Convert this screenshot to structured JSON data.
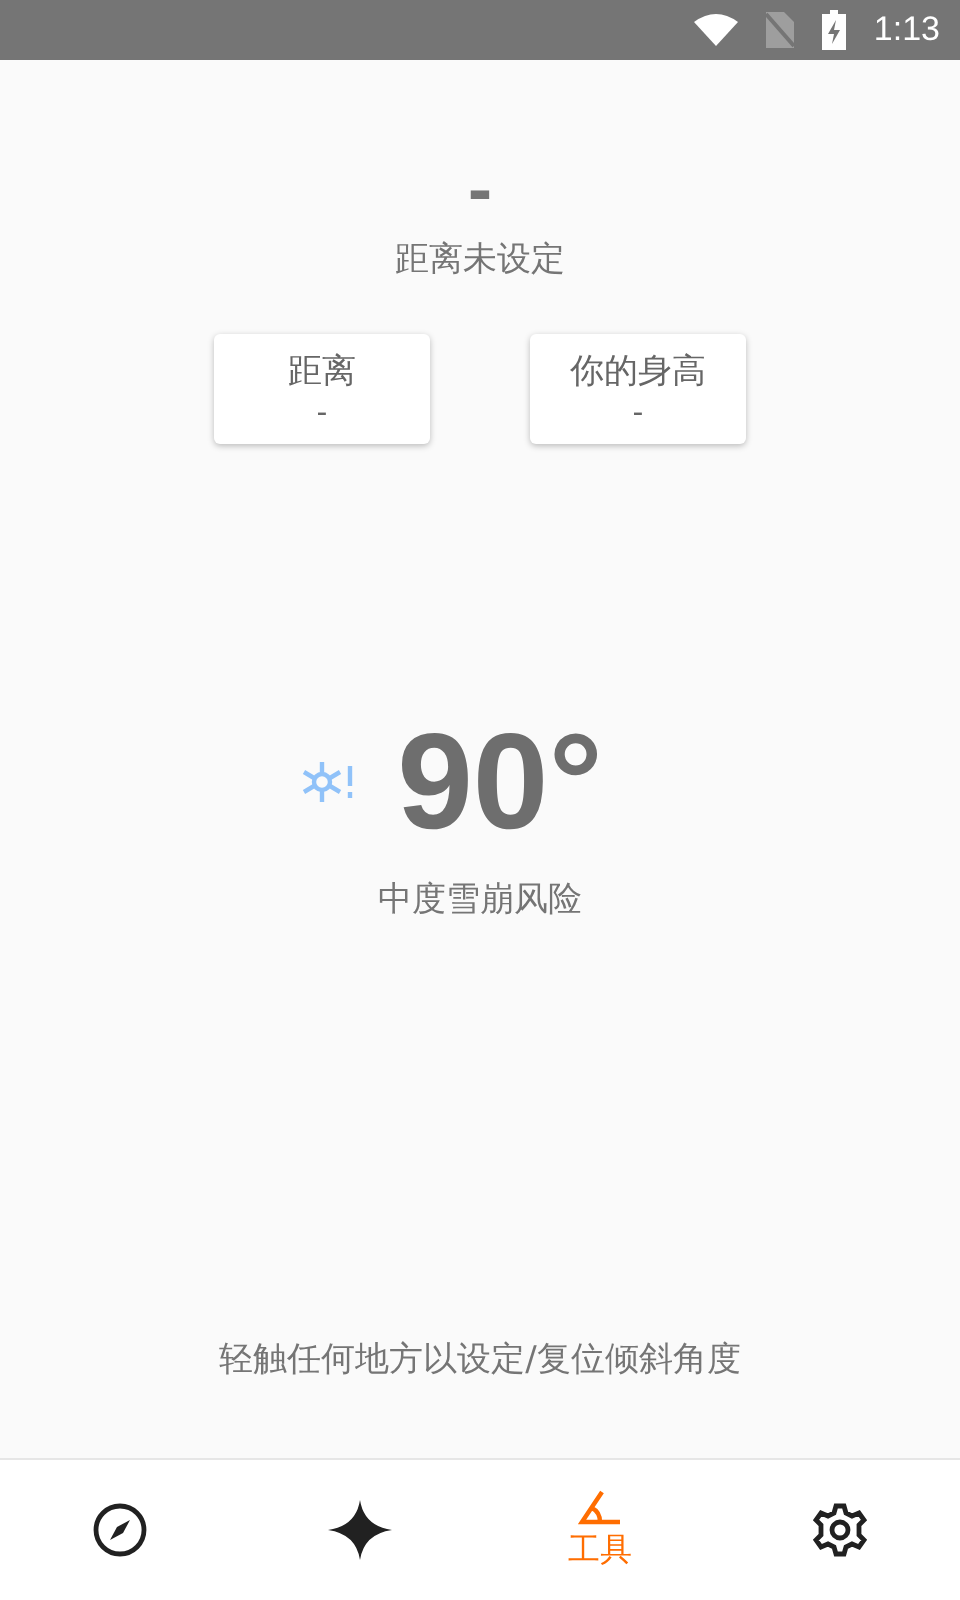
{
  "status_bar": {
    "time": "1:13"
  },
  "reading": {
    "value": "-",
    "caption": "距离未设定"
  },
  "cards": [
    {
      "label": "距离",
      "value": "-"
    },
    {
      "label": "你的身高",
      "value": "-"
    }
  ],
  "angle": {
    "value": "90°",
    "risk": "中度雪崩风险"
  },
  "hint": "轻触任何地方以设定/复位倾斜角度",
  "nav": [
    {
      "kind": "compass",
      "selected": false
    },
    {
      "kind": "star",
      "selected": false
    },
    {
      "kind": "angle",
      "label": "工具",
      "selected": true
    },
    {
      "kind": "settings",
      "selected": false
    }
  ]
}
